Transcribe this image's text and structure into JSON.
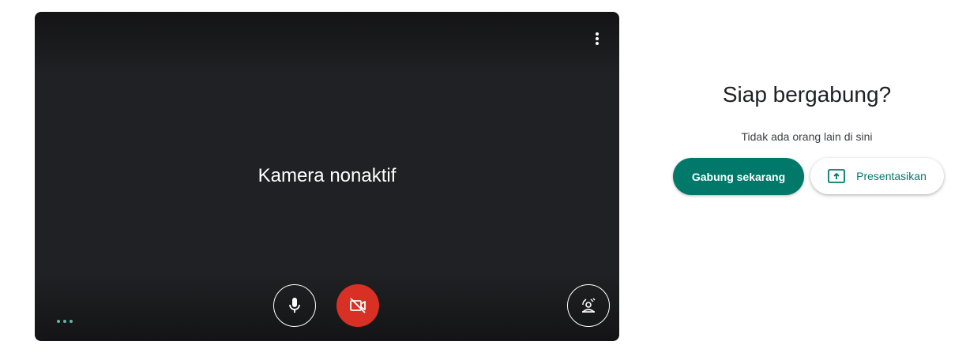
{
  "preview": {
    "camera_status": "Kamera nonaktif"
  },
  "join": {
    "title": "Siap bergabung?",
    "status": "Tidak ada orang lain di sini",
    "join_label": "Gabung sekarang",
    "present_label": "Presentasikan"
  },
  "icons": {
    "more": "more-vert-icon",
    "mic": "mic-icon",
    "camera_off": "videocam-off-icon",
    "effects": "visual-effects-icon",
    "present": "present-to-all-icon",
    "dots": "audio-level-dots-icon"
  },
  "colors": {
    "accent": "#00796b",
    "camera_off_red": "#d93025",
    "preview_bg": "#202124"
  }
}
